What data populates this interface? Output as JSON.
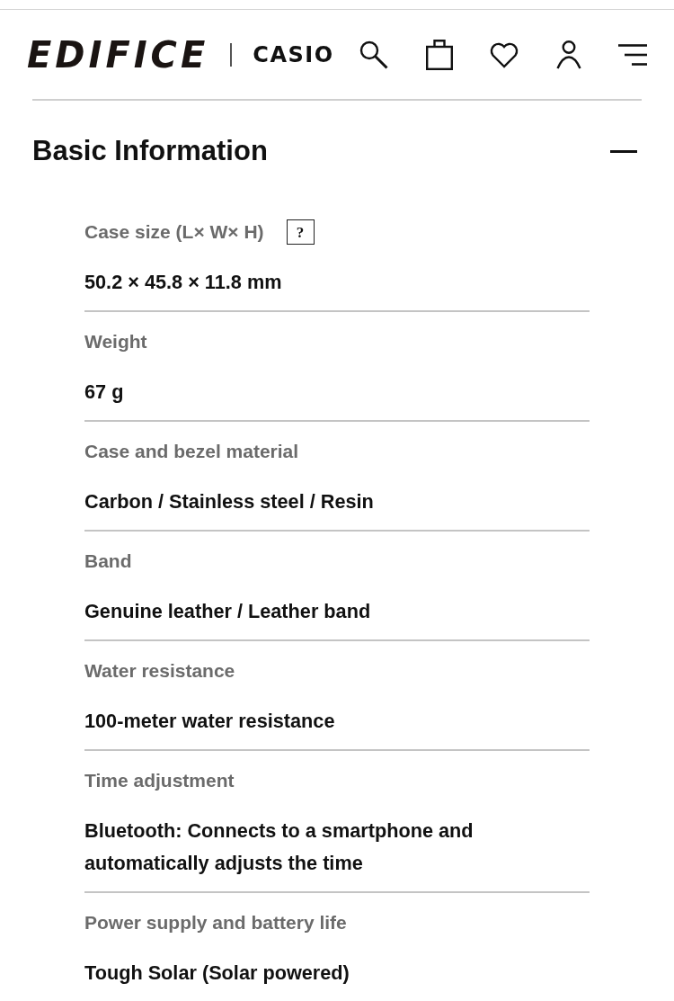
{
  "header": {
    "brand": "EDIFICE",
    "maker": "CASIO"
  },
  "section": {
    "title": "Basic Information",
    "expanded": true,
    "specs": [
      {
        "label": "Case size (L× W× H)",
        "help": "?",
        "value": "50.2 × 45.8 × 11.8 mm"
      },
      {
        "label": "Weight",
        "value": "67 g"
      },
      {
        "label": "Case and bezel material",
        "value": "Carbon / Stainless steel / Resin"
      },
      {
        "label": "Band",
        "value": "Genuine leather / Leather band"
      },
      {
        "label": "Water resistance",
        "value": "100-meter water resistance"
      },
      {
        "label": "Time adjustment",
        "value": "Bluetooth: Connects to a smartphone and automatically adjusts the time"
      },
      {
        "label": "Power supply and battery life",
        "value": "Tough Solar (Solar powered)"
      }
    ]
  }
}
